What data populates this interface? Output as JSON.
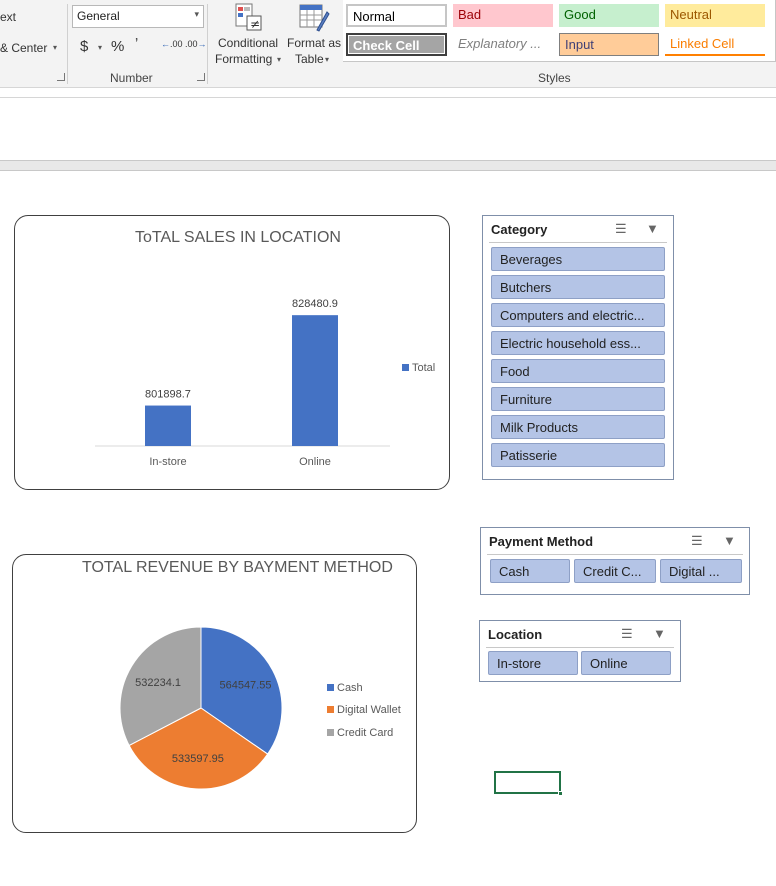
{
  "ribbon": {
    "alignment": {
      "wrap_text_partial": "ext",
      "merge_center_partial": "& Center"
    },
    "number": {
      "format_value": "General",
      "currency_symbol": "$",
      "percent_symbol": "%",
      "comma_symbol": "ʼ",
      "increase_decimal_label": ".00",
      "decrease_decimal_label": ".00",
      "group_label": "Number"
    },
    "styles": {
      "conditional_formatting_line1": "Conditional",
      "conditional_formatting_line2": "Formatting",
      "format_as_table_line1": "Format as",
      "format_as_table_line2": "Table",
      "group_label": "Styles",
      "cells": [
        {
          "label": "Normal",
          "bg": "#ffffff",
          "fg": "#000000"
        },
        {
          "label": "Bad",
          "bg": "#ffc7ce",
          "fg": "#9c0006"
        },
        {
          "label": "Good",
          "bg": "#c6efce",
          "fg": "#006100"
        },
        {
          "label": "Neutral",
          "bg": "#ffeb9c",
          "fg": "#9c5700"
        },
        {
          "label": "Check Cell",
          "bg": "#a5a5a5",
          "fg": "#ffffff"
        },
        {
          "label": "Explanatory ...",
          "bg": "#ffffff",
          "fg": "#7f7f7f"
        },
        {
          "label": "Input",
          "bg": "#ffcc99",
          "fg": "#3f3f76"
        },
        {
          "label": "Linked Cell",
          "bg": "#ffffff",
          "fg": "#fa7d00"
        }
      ]
    }
  },
  "bar_chart": {
    "chart_data": {
      "type": "bar",
      "title": "ToTAL SALES IN LOCATION",
      "categories": [
        "In-store",
        "Online"
      ],
      "series": [
        {
          "name": "Total",
          "values": [
            801898.7,
            828480.9
          ],
          "color": "#4472c4"
        }
      ],
      "data_labels": [
        "801898.7",
        "828480.9"
      ],
      "ylim": [
        790000,
        830000
      ],
      "grid": false,
      "legend": "right"
    }
  },
  "pie_chart": {
    "chart_data": {
      "type": "pie",
      "title": "TOTAL REVENUE BY BAYMENT METHOD",
      "labels": [
        "Cash",
        "Digital Wallet",
        "Credit Card"
      ],
      "values": [
        564547.55,
        533597.95,
        532234.1
      ],
      "data_labels": [
        "564547.55",
        "533597.95",
        "532234.1"
      ],
      "colors": [
        "#4472c4",
        "#ed7d31",
        "#a5a5a5"
      ],
      "legend": "right"
    }
  },
  "slicers": {
    "category": {
      "title": "Category",
      "items": [
        "Beverages",
        "Butchers",
        "Computers and electric...",
        "Electric household ess...",
        "Food",
        "Furniture",
        "Milk Products",
        "Patisserie"
      ]
    },
    "payment": {
      "title": "Payment Method",
      "items": [
        "Cash",
        "Credit C...",
        "Digital ..."
      ]
    },
    "location": {
      "title": "Location",
      "items": [
        "In-store",
        "Online"
      ]
    },
    "multiselect_icon": "multi-select-icon",
    "clear_filter_icon": "clear-filter-icon"
  },
  "colors": {
    "accent_green": "#217346",
    "slicer_item": "#b4c4e6"
  }
}
